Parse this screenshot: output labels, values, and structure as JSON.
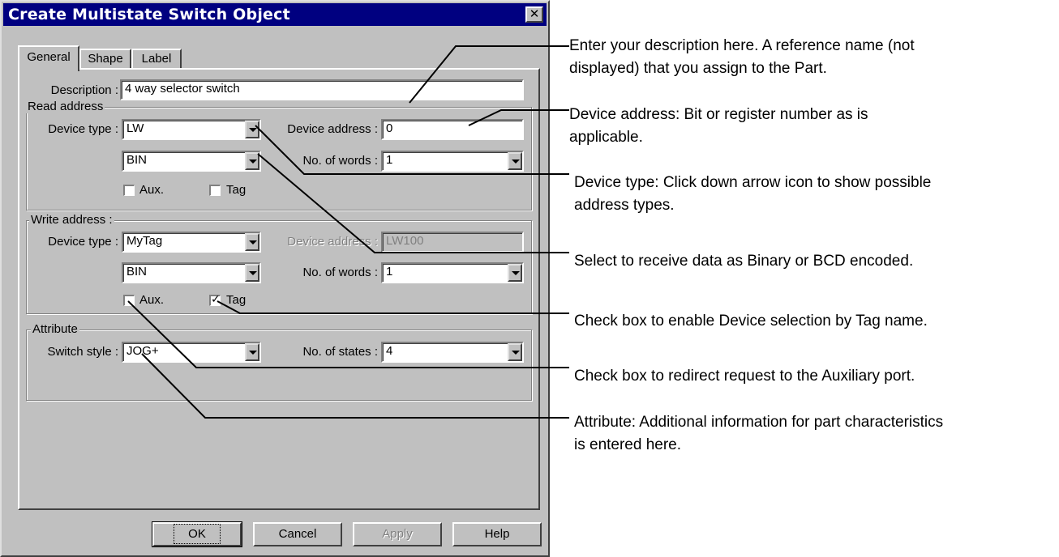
{
  "window": {
    "title": "Create Multistate Switch  Object",
    "close_glyph": "✕"
  },
  "tabs": [
    {
      "label": "General",
      "active": true
    },
    {
      "label": "Shape",
      "active": false
    },
    {
      "label": "Label",
      "active": false
    }
  ],
  "description": {
    "label": "Description :",
    "value": "4 way selector switch"
  },
  "read_address": {
    "group_title": "Read address",
    "device_type_label": "Device type :",
    "device_type_value": "LW",
    "device_address_label": "Device address :",
    "device_address_value": "0",
    "format_value": "BIN",
    "words_label": "No. of words :",
    "words_value": "1",
    "aux_label": "Aux.",
    "aux_checked": false,
    "tag_label": "Tag",
    "tag_checked": false
  },
  "write_address": {
    "group_title": "Write address :",
    "device_type_label": "Device type :",
    "device_type_value": "MyTag",
    "device_address_label": "Device address :",
    "device_address_value": "LW100",
    "format_value": "BIN",
    "words_label": "No. of words :",
    "words_value": "1",
    "aux_label": "Aux.",
    "aux_checked": false,
    "tag_label": "Tag",
    "tag_checked": true,
    "check_glyph": "✓"
  },
  "attribute": {
    "group_title": "Attribute",
    "switch_style_label": "Switch style :",
    "switch_style_value": "JOG+",
    "states_label": "No. of states :",
    "states_value": "4"
  },
  "buttons": {
    "ok": "OK",
    "cancel": "Cancel",
    "apply": "Apply",
    "help": "Help"
  },
  "annotations": {
    "description": [
      "Enter your description here. A reference name (not",
      "displayed) that you assign to the Part."
    ],
    "device_address": [
      "Device address: Bit or register number as is",
      "applicable."
    ],
    "device_type": [
      "Device type: Click down arrow icon to show possible",
      "address types."
    ],
    "format": [
      "Select to receive data as Binary or BCD encoded."
    ],
    "tag": [
      "Check box to enable Device selection by Tag name."
    ],
    "aux": [
      "Check box to redirect request to the Auxiliary port."
    ],
    "attribute": [
      "Attribute: Additional information for part characteristics",
      "is entered here."
    ]
  }
}
